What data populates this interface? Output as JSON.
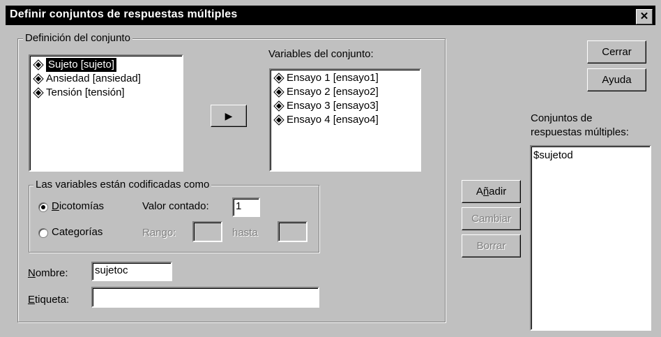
{
  "window": {
    "title": "Definir conjuntos de respuestas múltiples",
    "close_label": "✕"
  },
  "set_definition": {
    "legend": "Definición del conjunto",
    "source_variables": [
      {
        "label": "Sujeto [sujeto]",
        "selected": true
      },
      {
        "label": "Ansiedad [ansiedad]",
        "selected": false
      },
      {
        "label": "Tensión [tensión]",
        "selected": false
      }
    ],
    "move_button_label": "▶",
    "set_variables_label": "Variables del conjunto:",
    "set_variables": [
      {
        "label": "Ensayo 1 [ensayo1]"
      },
      {
        "label": "Ensayo 2 [ensayo2]"
      },
      {
        "label": "Ensayo 3 [ensayo3]"
      },
      {
        "label": "Ensayo 4 [ensayo4]"
      }
    ],
    "coding": {
      "legend": "Las variables están codificadas como",
      "dichotomies": {
        "pre": "",
        "ul": "D",
        "post": "icotomías",
        "checked": true
      },
      "counted_value_label": "Valor contado:",
      "counted_value": "1",
      "categories": {
        "pre": "Cate",
        "ul": "g",
        "post": "orías",
        "checked": false
      },
      "range_label": "Rango:",
      "range_from": "",
      "to_label": "hasta",
      "range_to": ""
    },
    "name": {
      "pre": "",
      "ul": "N",
      "post": "ombre:",
      "value": "sujetoc"
    },
    "tag": {
      "pre": "",
      "ul": "E",
      "post": "tiqueta:",
      "value": ""
    }
  },
  "buttons": {
    "close": "Cerrar",
    "help": "Ayuda",
    "add": {
      "pre": "A",
      "ul": "ñ",
      "post": "adir"
    },
    "change": "Cambiar",
    "remove": "Borrar"
  },
  "sets_list": {
    "label_line1": {
      "pre": "Con",
      "ul": "j",
      "post": "untos de"
    },
    "label_line2": "respuestas múltiples:",
    "items": [
      "$sujetod"
    ]
  }
}
